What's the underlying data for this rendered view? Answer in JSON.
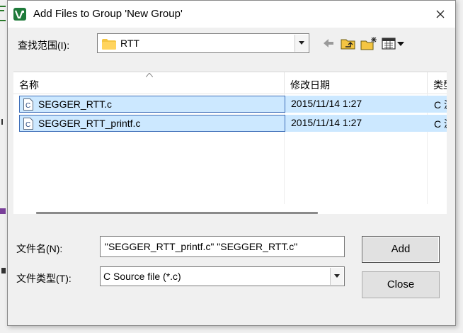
{
  "title": "Add Files to Group 'New Group'",
  "look_in": {
    "label": "查找范围(I):",
    "value": "RTT"
  },
  "toolbar": {
    "icons": [
      "back-arrow-icon",
      "up-folder-icon",
      "new-folder-icon",
      "view-menu-icon"
    ]
  },
  "file_list": {
    "columns": [
      "名称",
      "修改日期",
      "类型"
    ],
    "rows": [
      {
        "name": "SEGGER_RTT.c",
        "date": "2015/11/14 1:27",
        "type": "C 源",
        "selected": true
      },
      {
        "name": "SEGGER_RTT_printf.c",
        "date": "2015/11/14 1:27",
        "type": "C 源",
        "selected": true
      }
    ]
  },
  "filename": {
    "label": "文件名(N):",
    "value": "\"SEGGER_RTT_printf.c\" \"SEGGER_RTT.c\""
  },
  "filetype": {
    "label": "文件类型(T):",
    "value": "C Source file (*.c)"
  },
  "buttons": {
    "add": "Add",
    "close": "Close"
  },
  "colors": {
    "selection": "#cce8ff",
    "selection_border": "#3c6db8",
    "folder": "#f4c542",
    "app_icon": "#1e7a3a"
  }
}
